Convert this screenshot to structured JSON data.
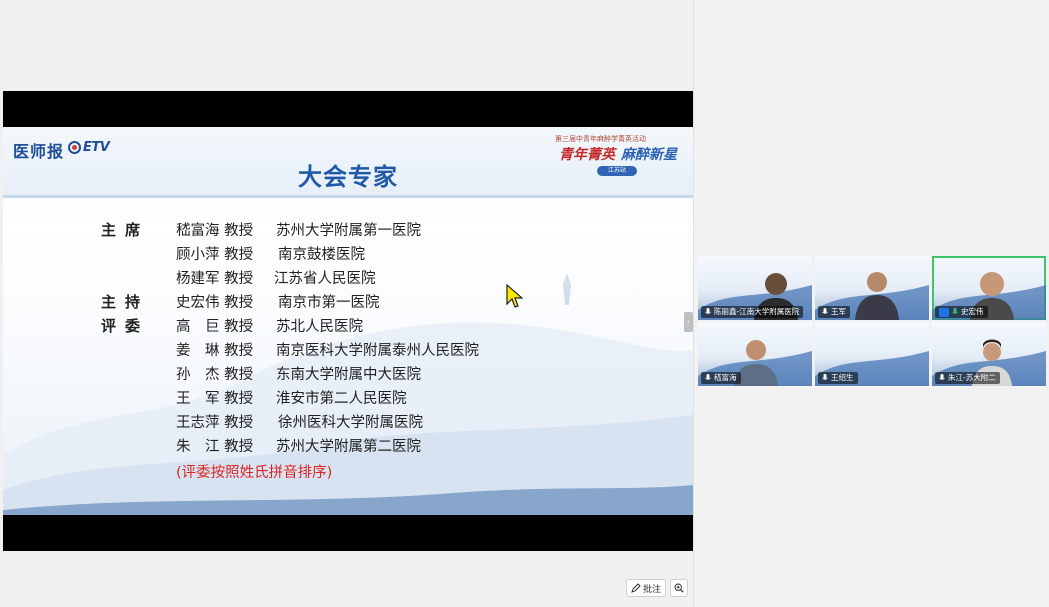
{
  "slide": {
    "logo_left": "医师报",
    "logo_etv": "ETV",
    "event_line": "第三届中青年麻醉学菁英活动",
    "event_name_a": "青年菁英",
    "event_name_b": "麻醉新星",
    "event_badge": "江苏站",
    "title": "大会专家",
    "rows": [
      {
        "role": "主席",
        "name": "嵇富海 教授",
        "hospital": "苏州大学附属第一医院"
      },
      {
        "role": "",
        "name": "顾小萍 教授",
        "hospital": "南京鼓楼医院"
      },
      {
        "role": "",
        "name": "杨建军 教授",
        "hospital": "江苏省人民医院"
      },
      {
        "role": "主持",
        "name": "史宏伟 教授",
        "hospital": "南京市第一医院"
      },
      {
        "role": "评委",
        "name": "高　巨 教授",
        "hospital": "苏北人民医院"
      },
      {
        "role": "",
        "name": "姜　琳 教授",
        "hospital": "南京医科大学附属泰州人民医院"
      },
      {
        "role": "",
        "name": "孙　杰 教授",
        "hospital": "东南大学附属中大医院"
      },
      {
        "role": "",
        "name": "王　军 教授",
        "hospital": "淮安市第二人民医院"
      },
      {
        "role": "",
        "name": "王志萍 教授",
        "hospital": "徐州医科大学附属医院"
      },
      {
        "role": "",
        "name": "朱　江 教授",
        "hospital": "苏州大学附属第二医院"
      }
    ],
    "note": "(评委按照姓氏拼音排序)"
  },
  "toolbar": {
    "annotate_label": "批注",
    "annotate_icon": "pencil-icon",
    "zoom_icon": "zoom-in-icon"
  },
  "participants": [
    {
      "name": "陈丽鑫-江南大学附属医院",
      "icon": "mic-icon",
      "active": false
    },
    {
      "name": "王军",
      "icon": "mic-icon",
      "active": false
    },
    {
      "name": "史宏伟",
      "icon": "mic-icon",
      "active": true
    },
    {
      "name": "嵇富海",
      "icon": "mic-icon",
      "active": false
    },
    {
      "name": "王绍生",
      "icon": "mic-icon",
      "active": false
    },
    {
      "name": "朱江-苏大附二",
      "icon": "mic-icon",
      "active": false
    }
  ],
  "colors": {
    "title_blue": "#1f5aa8",
    "note_red": "#e02424",
    "active_border": "#3ec46d"
  }
}
